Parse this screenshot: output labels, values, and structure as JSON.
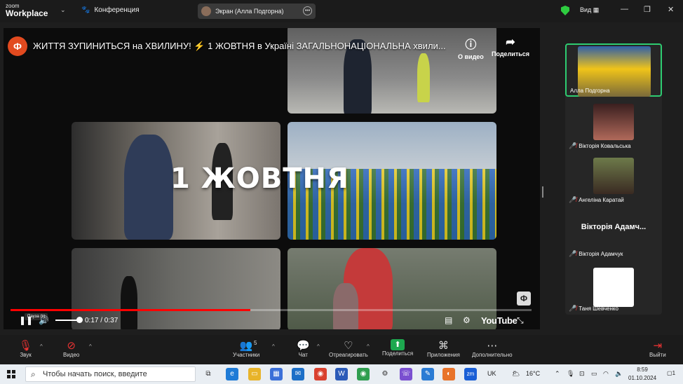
{
  "topbar": {
    "brand_small": "zoom",
    "brand_large": "Workplace",
    "meeting_label": "Конференция",
    "share_label": "Экран (Алла Подгорна)",
    "view_label": "Вид"
  },
  "video": {
    "channel_logo": "Ф",
    "title": "ЖИТТЯ ЗУПИНИТЬСЯ на ХВИЛИНУ! ⚡ 1 ЖОВТНЯ в Україні ЗАГАЛЬНОНАЦІОНАЛЬНА хвили...",
    "about_label": "О видео",
    "share_label": "Поделиться",
    "overlay_title": "1 ЖОВТНЯ",
    "pause_tooltip": "Пауза (k)",
    "time": "0:17 / 0:37",
    "progress": 0.46,
    "platform": "YouTube"
  },
  "participants": [
    {
      "name": "Алла Подгорна",
      "active": true,
      "muted": false,
      "photo": true
    },
    {
      "name": "Вікторія Ковальська",
      "active": false,
      "muted": true,
      "photo": true
    },
    {
      "name": "Ангеліна Каратай",
      "active": false,
      "muted": true,
      "photo": true
    },
    {
      "name": "Вікторія Адамчук",
      "active": false,
      "muted": true,
      "photo": false,
      "display_name": "Вікторія Адамч..."
    },
    {
      "name": "Таня Шевченко",
      "active": false,
      "muted": true,
      "photo": true
    }
  ],
  "toolbar": {
    "audio_label": "Звук",
    "video_label": "Видео",
    "participants_label": "Участники",
    "participants_count": "5",
    "chat_label": "Чат",
    "react_label": "Отреагировать",
    "share_label": "Поделиться",
    "apps_label": "Приложения",
    "more_label": "Дополнительно",
    "leave_label": "Выйти"
  },
  "taskbar": {
    "search_placeholder": "Чтобы начать поиск, введите",
    "language": "UK",
    "temperature": "16°C",
    "time": "8:59",
    "date": "01.10.2024",
    "notification_count": "1"
  },
  "colors": {
    "accent_green": "#1da84f",
    "active_border": "#2ecc71",
    "progress_red": "#ff0000",
    "muted_red": "#e33333"
  }
}
